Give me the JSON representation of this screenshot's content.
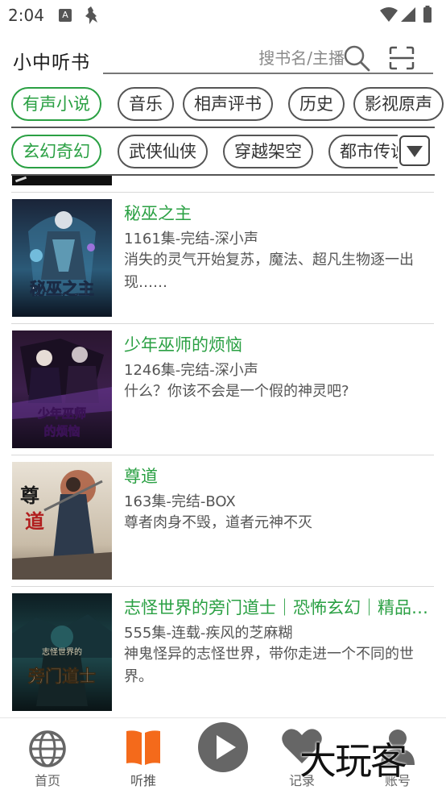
{
  "status_bar": {
    "time": "2:04",
    "icons": [
      "a-square-icon",
      "bird-icon",
      "wifi-icon",
      "signal-icon",
      "battery-icon"
    ]
  },
  "header": {
    "title": "小中听书",
    "search_placeholder": "搜书名/主播"
  },
  "categories": {
    "row1": [
      {
        "label": "有声小说",
        "active": true
      },
      {
        "label": "音乐",
        "active": false
      },
      {
        "label": "相声评书",
        "active": false
      },
      {
        "label": "历史",
        "active": false
      },
      {
        "label": "影视原声",
        "active": false
      }
    ],
    "row2": [
      {
        "label": "玄幻奇幻",
        "active": true
      },
      {
        "label": "武侠仙侠",
        "active": false
      },
      {
        "label": "穿越架空",
        "active": false
      },
      {
        "label": "都市传说",
        "active": false
      }
    ]
  },
  "books": [
    {
      "title": "秘巫之主",
      "meta": "1161集-完结-深小声",
      "desc": "消失的灵气开始复苏，魔法、超凡生物逐一出现……",
      "cover_text": "秘巫之主"
    },
    {
      "title": "少年巫师的烦恼",
      "meta": "1246集-完结-深小声",
      "desc": "什么？你该不会是一个假的神灵吧?",
      "cover_text": "少年巫师的烦恼"
    },
    {
      "title": "尊道",
      "meta": "163集-完结-BOX",
      "desc": "尊者肉身不毁，道者元神不灭",
      "cover_text": "尊道"
    },
    {
      "title": "志怪世界的旁门道士｜恐怖玄幻｜精品多人有声剧",
      "meta": "555集-连载-疾风的芝麻糊",
      "desc": "神鬼怪异的志怪世界，带你走进一个不同的世界。",
      "cover_text": "志怪世界的旁门道士"
    }
  ],
  "bottom_nav": [
    {
      "label": "首页",
      "icon": "globe-icon",
      "active": false
    },
    {
      "label": "听推",
      "icon": "open-book-icon",
      "active": true
    },
    {
      "label": "",
      "icon": "play-icon",
      "active": false
    },
    {
      "label": "记录",
      "icon": "heart-icon",
      "active": false
    },
    {
      "label": "账号",
      "icon": "person-icon",
      "active": false
    }
  ],
  "watermark": "大玩客",
  "colors": {
    "accent_green": "#2aa043",
    "accent_orange": "#f46a1b",
    "nav_gray": "#666666"
  }
}
